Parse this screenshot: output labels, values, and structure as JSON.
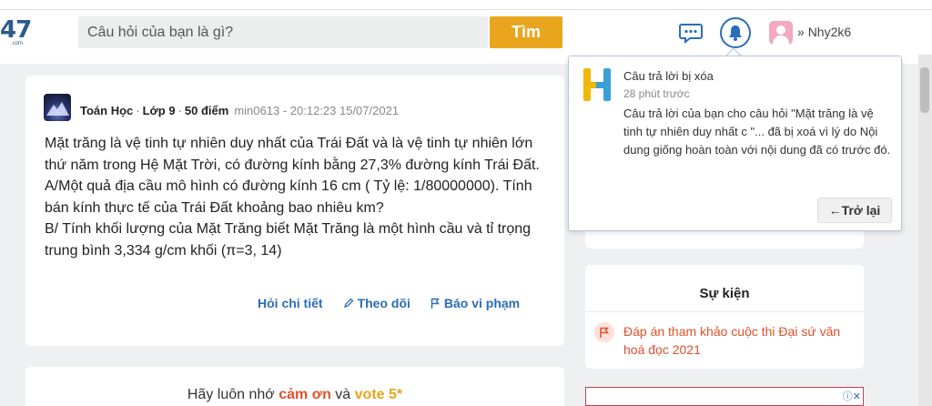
{
  "header": {
    "logo_text": "47",
    "logo_sub": ".com",
    "search_placeholder": "Câu hỏi của bạn là gì?",
    "search_button": "Tìm",
    "username": "Nhy2k6"
  },
  "question": {
    "subject": "Toán Học",
    "grade": "Lớp 9",
    "points": "50 điểm",
    "author_time": "min0613 - 20:12:23 15/07/2021",
    "body": "Mặt trăng là vệ tinh tự nhiên duy nhất của Trái Đất và là vệ tinh tự nhiên lớn thứ năm trong Hệ Mặt Trời, có đường kính bằng 27,3% đường kính Trái Đất.",
    "part_a": "A/Một quả địa cầu mô hình có đường kính 16 cm ( Tỷ lệ: 1/80000000). Tính bán kính thực tế của Trái Đất khoảng bao nhiêu km?",
    "part_b": "B/ Tính khối lượng của Mặt Trăng biết Mặt Trăng là một hình cầu và tỉ trọng trung bình 3,334 g/cm khối (π=3, 14)",
    "actions": {
      "details": "Hỏi chi tiết",
      "follow": "Theo dõi",
      "report": "Báo vi phạm"
    }
  },
  "thanks": {
    "prefix": "Hãy luôn nhớ",
    "thanks_word": "cảm ơn",
    "middle": "và",
    "vote": "vote 5*"
  },
  "events": {
    "title": "Sự kiện",
    "item": "Đáp án tham khảo cuộc thi Đại sứ văn hoá đọc 2021"
  },
  "notification": {
    "title": "Câu trả lời bị xóa",
    "time": "28 phút trước",
    "message": "Câu trả lời của bạn cho câu hỏi \"Mặt trăng là vệ tinh tự nhiên duy nhất c \"... đã bị xoá vì lý do Nội dung giống hoàn toàn với nội dung đã có trước đó.",
    "back_button": "←Trở lại"
  },
  "colors": {
    "accent_blue": "#2a6db8",
    "search_button": "#e8a51d",
    "highlight_red": "#e0502a",
    "logo_yellow": "#f2b705",
    "logo_blue": "#3aa0d8"
  }
}
